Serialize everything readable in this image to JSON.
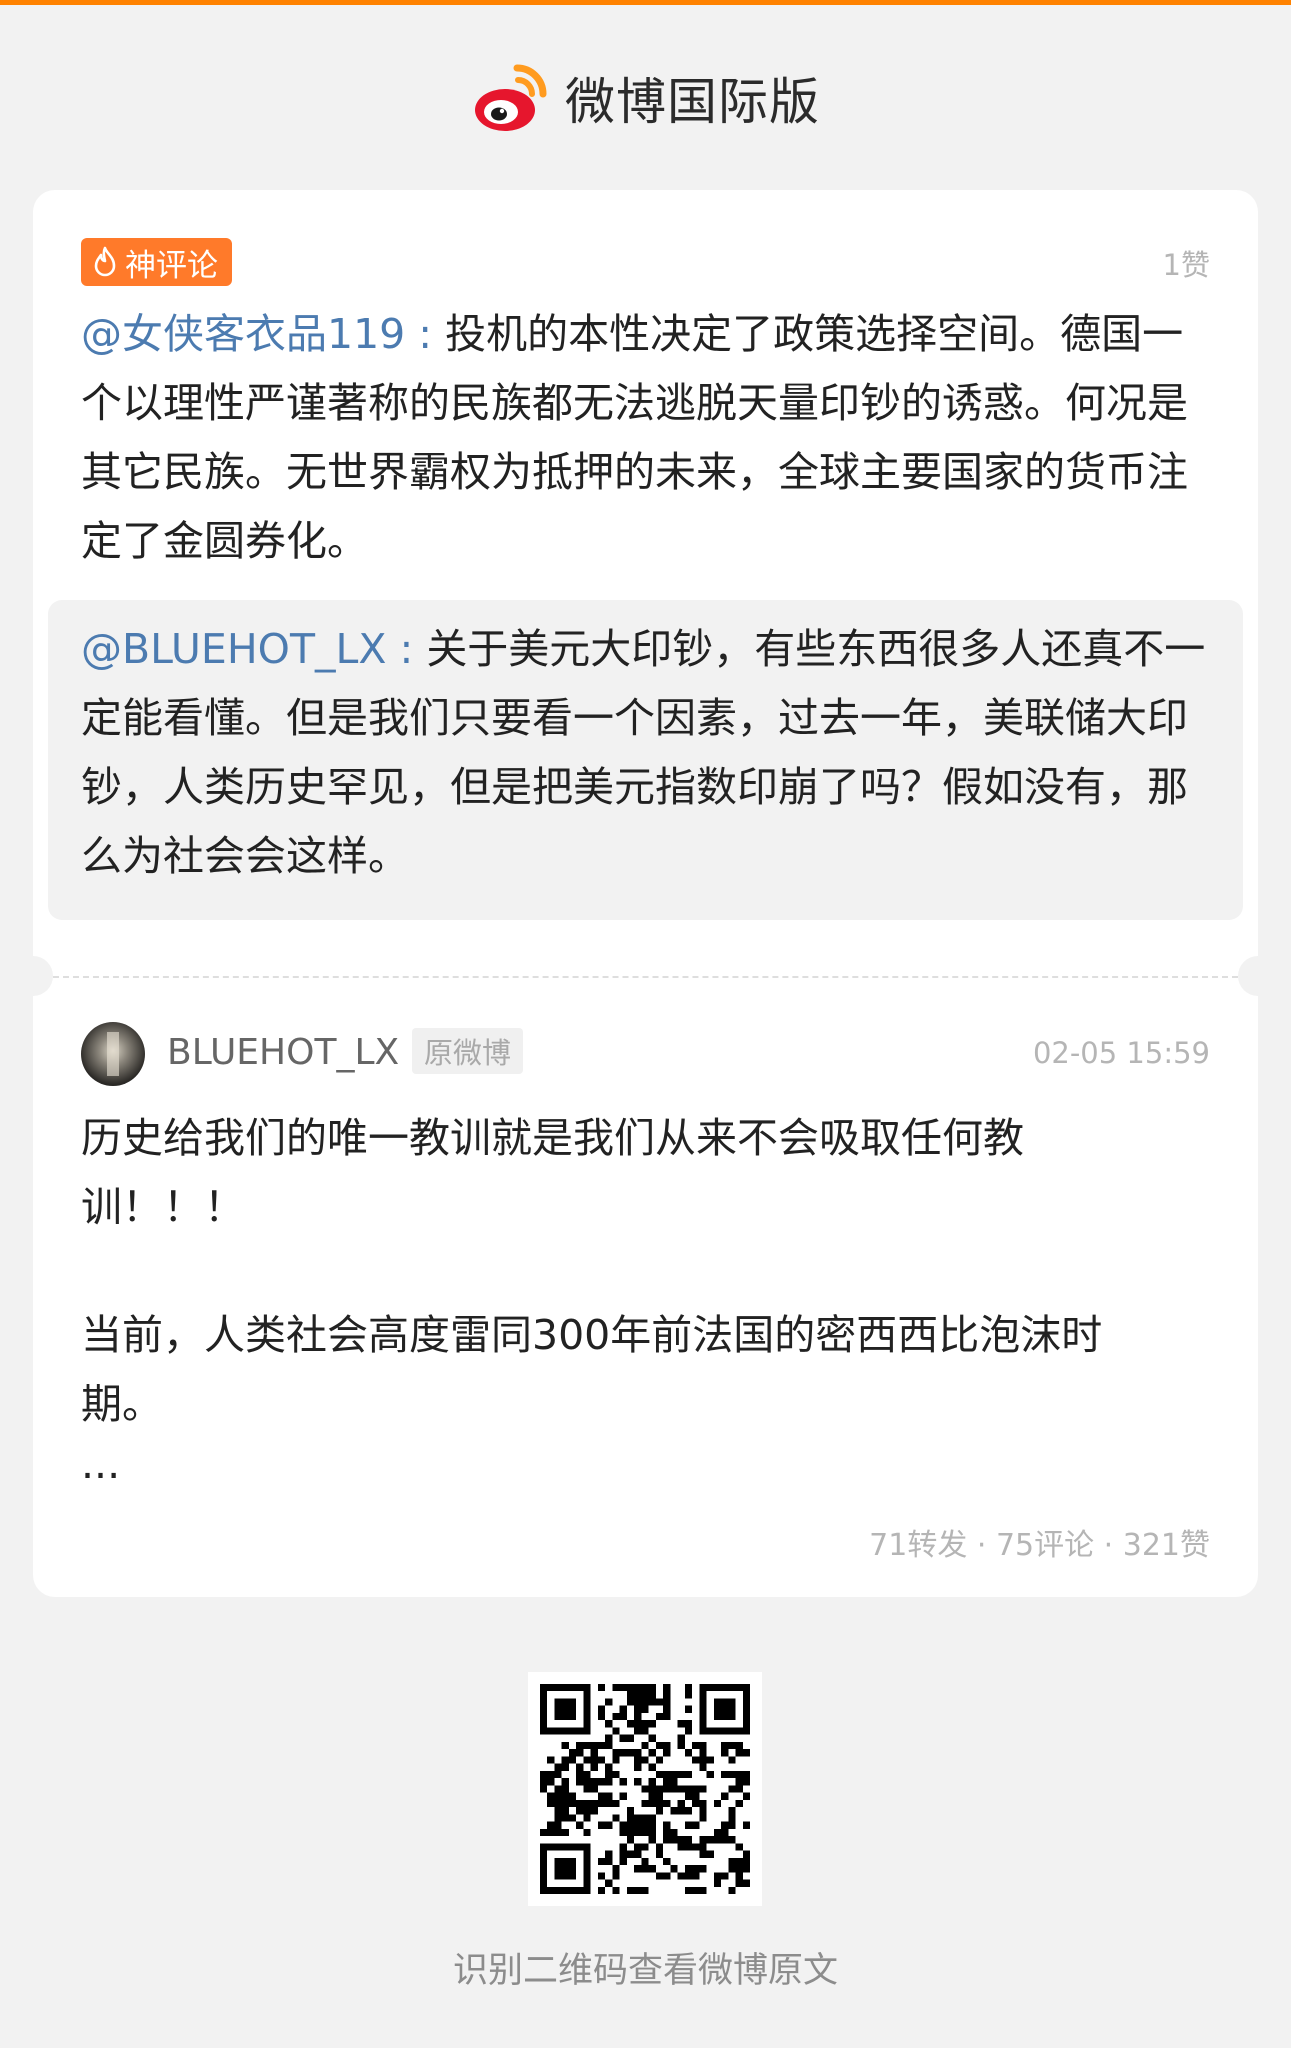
{
  "app": {
    "name": "微博国际版",
    "accent_color": "#ff8200",
    "logo_icon": "weibo-eye-logo"
  },
  "hot_comment": {
    "badge_label": "神评论",
    "badge_icon": "fire-icon",
    "badge_color": "#ff7a2a",
    "like_count": "1赞",
    "mention": "@女侠客衣品119",
    "separator": " : ",
    "text": "投机的本性决定了政策选择空间。德国一个以理性严谨著称的民族都无法逃脱天量印钞的诱惑。何况是其它民族。无世界霸权为抵押的未来，全球主要国家的货币注定了金圆券化。"
  },
  "quoted_reply": {
    "mention": "@BLUEHOT_LX",
    "separator": " : ",
    "text": "关于美元大印钞，有些东西很多人还真不一定能看懂。但是我们只要看一个因素，过去一年，美联储大印钞，人类历史罕见，但是把美元指数印崩了吗？假如没有，那么为社会会这样。"
  },
  "original_post": {
    "author": "BLUEHOT_LX",
    "tag": "原微博",
    "time": "02-05 15:59",
    "paragraphs": [
      "历史给我们的唯一教训就是我们从来不会吸取任何教训！！！",
      "当前，人类社会高度雷同300年前法国的密西西比泡沫时期。",
      "..."
    ],
    "stats": "71转发 · 75评论 · 321赞"
  },
  "footer": {
    "qr_icon": "qr-code",
    "hint": "识别二维码查看微博原文"
  }
}
